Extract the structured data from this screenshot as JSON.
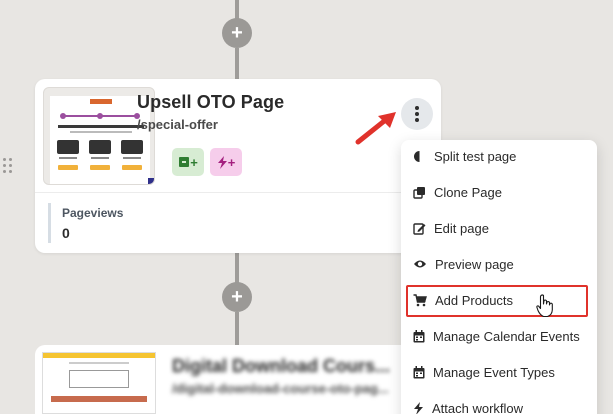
{
  "card": {
    "title": "Upsell OTO Page",
    "slug": "/special-offer",
    "stat_label": "Pageviews",
    "stat_value": "0",
    "chip_green_label": "+",
    "chip_pink_label": "+"
  },
  "card2": {
    "title": "Digital Download Cours...",
    "slug": "/digital-download-course-oto-pag..."
  },
  "menu": {
    "items": [
      {
        "label": "Split test page",
        "icon": "half-circle-icon"
      },
      {
        "label": "Clone Page",
        "icon": "copy-icon"
      },
      {
        "label": "Edit page",
        "icon": "edit-icon"
      },
      {
        "label": "Preview page",
        "icon": "eye-icon"
      },
      {
        "label": "Add Products",
        "icon": "cart-icon"
      },
      {
        "label": "Manage Calendar Events",
        "icon": "calendar-icon"
      },
      {
        "label": "Manage Event Types",
        "icon": "calendar-icon"
      },
      {
        "label": "Attach workflow",
        "icon": "bolt-icon"
      }
    ]
  },
  "nodes": {
    "add_symbol": "+"
  },
  "colors": {
    "highlight": "#e0322b",
    "arrow": "#e0322b",
    "chip_green_bg": "#d7ecd3",
    "chip_pink_bg": "#f6cdeb"
  }
}
